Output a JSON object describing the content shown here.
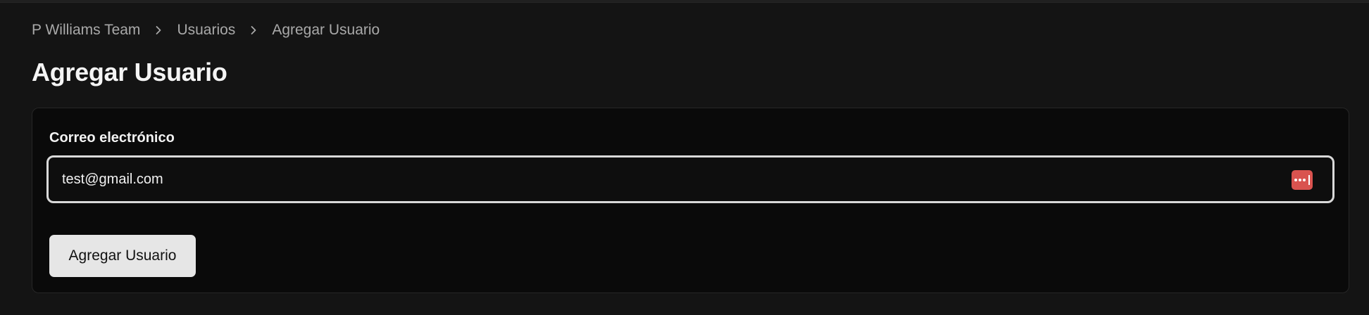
{
  "breadcrumb": {
    "items": [
      {
        "label": "P Williams Team"
      },
      {
        "label": "Usuarios"
      },
      {
        "label": "Agregar Usuario"
      }
    ]
  },
  "page": {
    "title": "Agregar Usuario"
  },
  "form": {
    "email_label": "Correo electrónico",
    "email_value": "test@gmail.com",
    "submit_label": "Agregar Usuario"
  },
  "icons": {
    "breadcrumb_separator": "chevron-right-icon",
    "password_manager": "password-manager-icon"
  },
  "colors": {
    "background": "#141414",
    "card": "#0a0a0a",
    "input_border": "#d9d9d9",
    "password_manager_accent": "#d9534f",
    "button_bg": "#e6e6e6"
  }
}
